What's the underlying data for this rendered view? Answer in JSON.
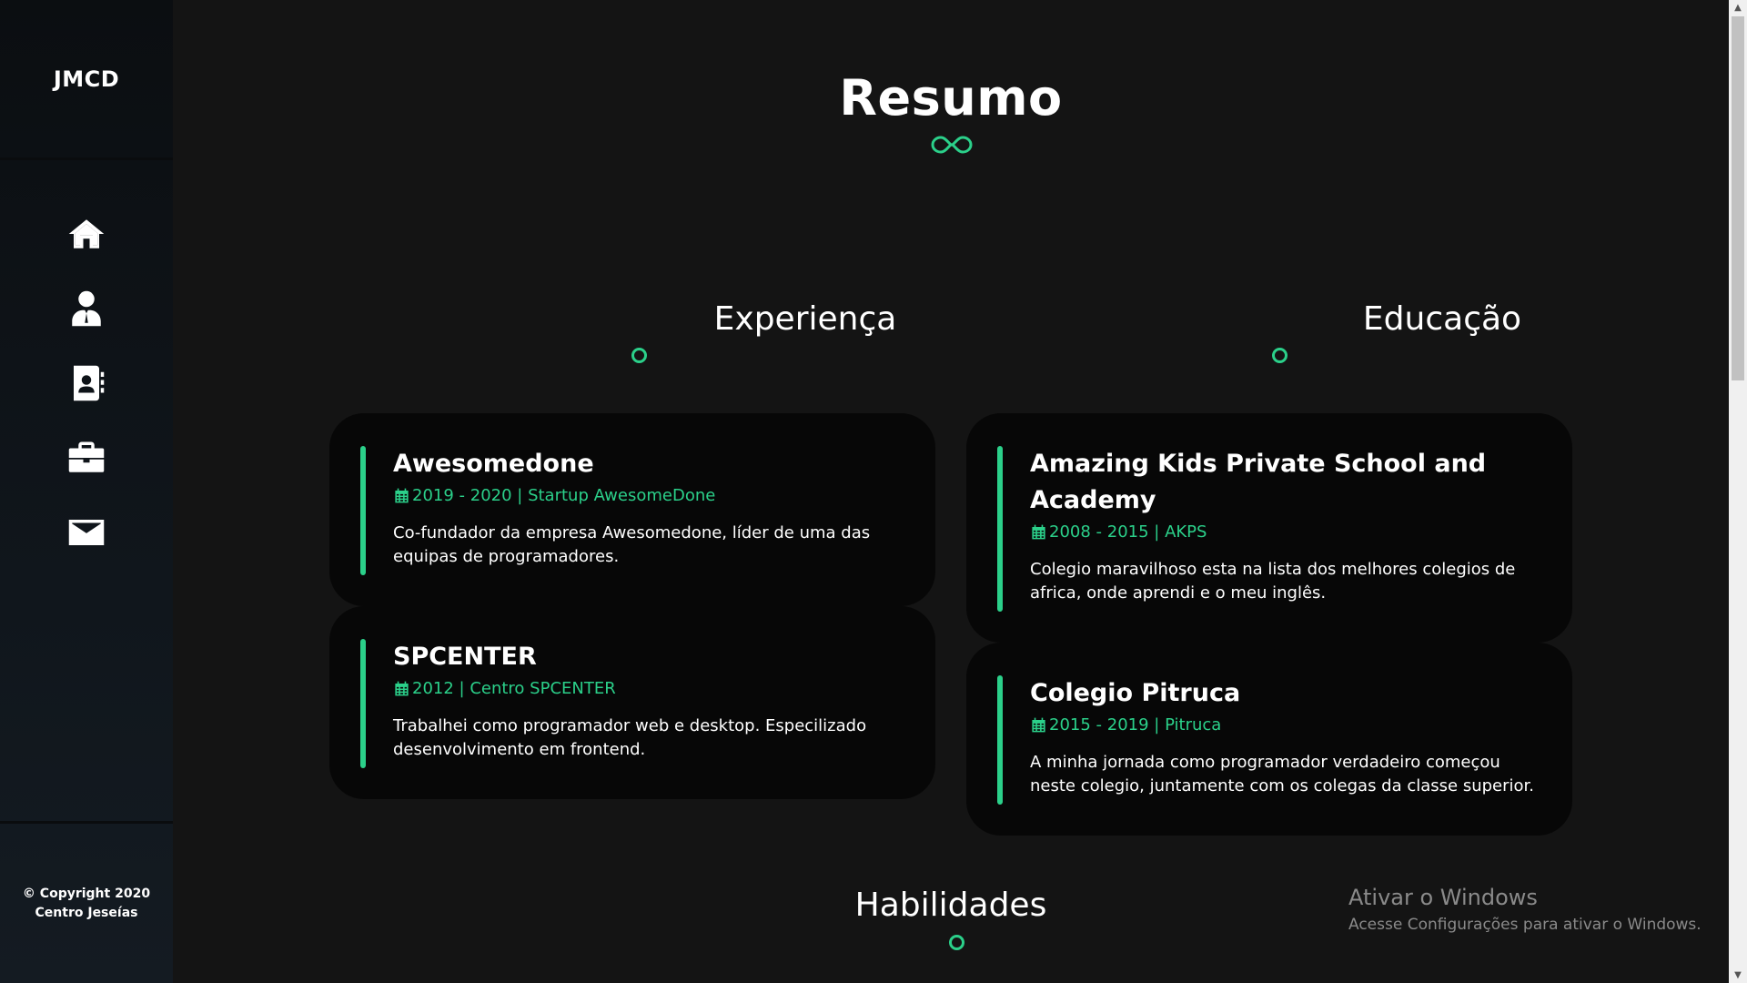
{
  "sidebar": {
    "brand": "JMCD",
    "nav": [
      {
        "icon": "home-icon"
      },
      {
        "icon": "user-tie-icon"
      },
      {
        "icon": "address-book-icon"
      },
      {
        "icon": "briefcase-icon"
      },
      {
        "icon": "envelope-icon"
      }
    ],
    "copyright_line1": "© Copyright 2020",
    "copyright_line2": "Centro Jeseías"
  },
  "main": {
    "title": "Resumo",
    "experience": {
      "heading": "Experiença",
      "items": [
        {
          "title": "Awesomedone",
          "meta": "2019 - 2020 | Startup AwesomeDone",
          "description": "Co-fundador da empresa Awesomedone, líder de uma das equipas de programadores."
        },
        {
          "title": "SPCENTER",
          "meta": "2012 | Centro SPCENTER",
          "description": "Trabalhei como programador web e desktop. Especilizado desenvolvimento em frontend."
        }
      ]
    },
    "education": {
      "heading": "Educação",
      "items": [
        {
          "title": "Amazing Kids Private School and Academy",
          "meta": "2008 - 2015 | AKPS",
          "description": "Colegio maravilhoso esta na lista dos melhores colegios de africa, onde aprendi e o meu inglês."
        },
        {
          "title": "Colegio Pitruca",
          "meta": "2015 - 2019 | Pitruca",
          "description": "A minha jornada como programador verdadeiro começou neste colegio, juntamente com os colegas da classe superior."
        }
      ]
    },
    "skills_heading": "Habilidades"
  },
  "watermark": {
    "line1": "Ativar o Windows",
    "line2": "Acesse Configurações para ativar o Windows."
  },
  "colors": {
    "accent": "#2bd08a",
    "background": "#141414",
    "card": "#070707",
    "sidebar": "#0b0e11"
  }
}
